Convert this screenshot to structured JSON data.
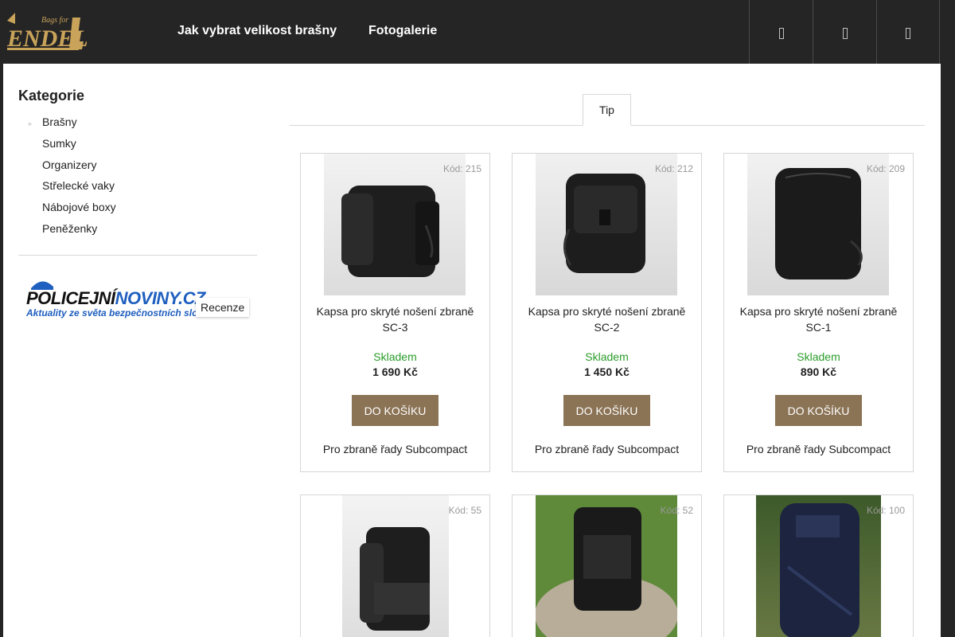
{
  "header": {
    "logo_small_text": "Bags for",
    "logo_text": "ENDEL",
    "nav": [
      "Jak vybrat velikost brašny",
      "Fotogalerie"
    ],
    "icons": [
      "search-icon",
      "user-icon",
      "cart-icon"
    ]
  },
  "sidebar": {
    "title": "Kategorie",
    "categories": [
      "Brašny",
      "Sumky",
      "Organizery",
      "Střelecké vaky",
      "Nábojové boxy",
      "Peněženky"
    ],
    "banner": {
      "title_part1": "POLICEJNÍ",
      "title_part2": "NOVINY.CZ",
      "tagline": "Aktuality ze světa bezpečnostních složek",
      "recenze": "Recenze"
    }
  },
  "tabs": {
    "active": "Tip"
  },
  "products": [
    {
      "code": "Kód: 215",
      "name": "Kapsa pro skryté nošení zbraně SC-3",
      "stock": "Skladem",
      "price": "1 690 Kč",
      "button": "DO KOŠÍKU",
      "desc": "Pro zbraně řady Subcompact"
    },
    {
      "code": "Kód: 212",
      "name": "Kapsa pro skryté nošení zbraně SC-2",
      "stock": "Skladem",
      "price": "1 450 Kč",
      "button": "DO KOŠÍKU",
      "desc": "Pro zbraně řady Subcompact"
    },
    {
      "code": "Kód: 209",
      "name": "Kapsa pro skryté nošení zbraně SC-1",
      "stock": "Skladem",
      "price": "890 Kč",
      "button": "DO KOŠÍKU",
      "desc": "Pro zbraně řady Subcompact"
    },
    {
      "code": "Kód: 55"
    },
    {
      "code": "Kód: 52"
    },
    {
      "code": "Kód: 100"
    }
  ],
  "colors": {
    "header_bg": "#252525",
    "button_bg": "#8b7355",
    "stock_green": "#2a9d2a",
    "logo_gold": "#c9a35a"
  }
}
